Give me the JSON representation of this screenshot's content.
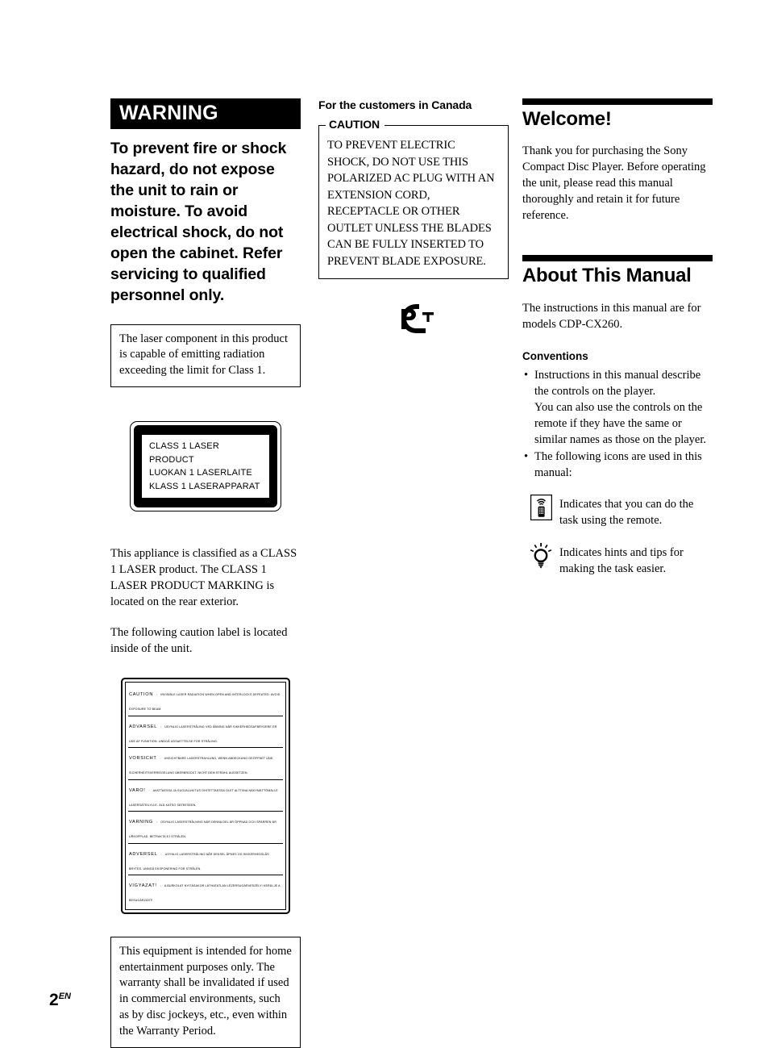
{
  "page": {
    "number": "2",
    "region_code": "EN"
  },
  "left_column": {
    "warning_heading": "WARNING",
    "warning_text": "To prevent fire or shock hazard, do not expose the unit to rain or moisture.\nTo avoid electrical shock, do not open the cabinet. Refer servicing to qualified personnel only.",
    "laser_note_box": "The laser component in this product is capable of emitting radiation exceeding the limit for Class 1.",
    "laser_product_label": "CLASS 1 LASER PRODUCT\nLUOKAN 1 LASERLAITE\nKLASS 1 LASERAPPARAT",
    "classified_paragraph": "This appliance is classified as a CLASS 1 LASER product. The CLASS 1 LASER PRODUCT MARKING is located on the rear exterior.",
    "caution_label_paragraph": "The following caution label is located inside of the unit.",
    "caution_label": {
      "rows": [
        {
          "language": "CAUTION",
          "separator": ":",
          "text": "INVISIBLE LASER RADIATION WHEN OPEN AND INTERLOCKS DEFEATED. AVOID EXPOSURE TO BEAM."
        },
        {
          "language": "ADVARSEL",
          "separator": ":",
          "text": "USYNLIG LASERSTRÅLING VED ÅBNING NÅR SIKKERHEDSAFBRYDERE ER UDE AF FUNKTION. UNDGÅ UDSAETTELSE FOR STRÅLING."
        },
        {
          "language": "VORSICHT",
          "separator": ":",
          "text": "UNSICHTBARE LASERSTRAHLUNG, WENN ABDECKUNG GEÖFFNET UND SICHERHEITSVERRIEGELUNG ÜBERBRÜCKT. NICHT DEM STRAHL AUSSETZEN."
        },
        {
          "language": "VARO!",
          "separator": ":",
          "text": "AVATTAESSA JA SUOJALUKITUS OHITETTAESSA OLET ALTTIINA NÄKYMÄTTÖMÄLLE LASERSÄTEILYLLE. ÄLÄ KATSO SÄTEESEEN."
        },
        {
          "language": "VARNING",
          "separator": ":",
          "text": "OSYNLIG LASERSTRÅLNING NÄR DENNA DEL ÄR ÖPPNAD OCH SPÄRREN ÄR URKOPPLAD. BETRAKTA EJ STRÅLEN."
        },
        {
          "language": "ADVERSEL",
          "separator": ":",
          "text": "USYNLIG LASERSTRÅLING NÅR DEKSEL ÅPNES OG SIKKERHEDSLÅS BRYTES. UNNGÅ EKSPONERING FOR STRÅLEN."
        },
        {
          "language": "VIGYAZAT!",
          "separator": ":",
          "text": "A BURKOLAT NYITÁSAKOR LÁTHATATLAN LÉZERSUGÁRVESZÉLY! KERÜLJE A BESUGÁRZÁST!"
        }
      ]
    },
    "home_use_box": "This equipment is intended for home entertainment purposes only. The warranty shall be invalidated if used in commercial environments, such as by disc jockeys, etc., even within the Warranty Period."
  },
  "middle_column": {
    "canada_heading": "For the customers in Canada",
    "caution_legend": "CAUTION",
    "caution_body": "TO PREVENT ELECTRIC SHOCK, DO NOT USE THIS POLARIZED AC PLUG WITH AN EXTENSION CORD, RECEPTACLE OR OTHER OUTLET UNLESS THE BLADES CAN BE FULLY INSERTED TO PREVENT BLADE EXPOSURE.",
    "certification_mark": "pct-gost-r-mark"
  },
  "right_column": {
    "welcome": {
      "title": "Welcome!",
      "body": "Thank you for purchasing the Sony Compact Disc Player. Before operating the unit, please read this manual thoroughly and retain it for future reference."
    },
    "about_manual": {
      "title": "About This Manual",
      "body": "The instructions in this manual are for models CDP-CX260.",
      "conventions_heading": "Conventions",
      "bullets": [
        {
          "main": "Instructions in this manual describe the controls on the player.",
          "continuation": "You can also use the controls on the remote if they have the same or similar names as those on the player."
        },
        {
          "main": "The following icons are used in this manual:",
          "continuation": ""
        }
      ],
      "icons": [
        {
          "icon": "remote-control-icon",
          "description": "Indicates that you can do the task using the remote."
        },
        {
          "icon": "lightbulb-icon",
          "description": "Indicates hints and tips for making the task easier."
        }
      ]
    }
  },
  "colors": {
    "ink": "#000000",
    "paper": "#ffffff"
  }
}
